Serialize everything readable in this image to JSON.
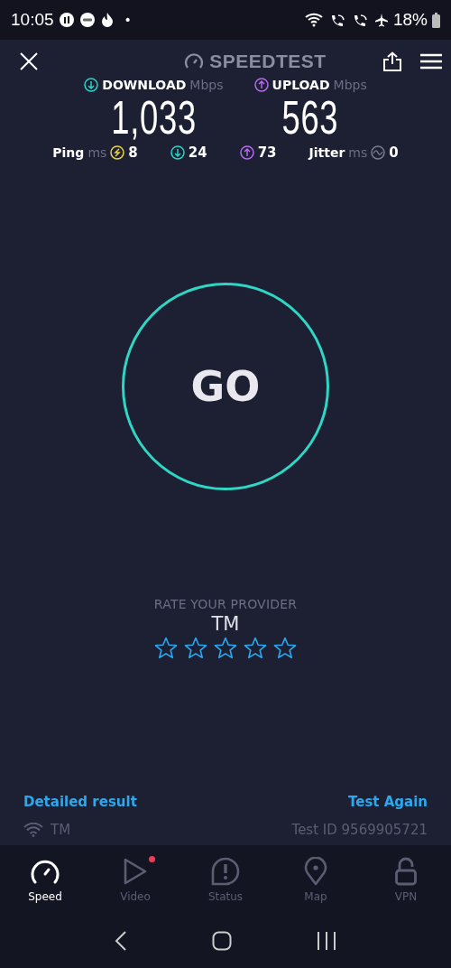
{
  "status_bar": {
    "time": "10:05",
    "dot": "•",
    "battery": "18%"
  },
  "header": {
    "title": "SPEEDTEST"
  },
  "results": [
    {
      "kind": "download",
      "label": "DOWNLOAD",
      "unit": "Mbps",
      "value": "1,033"
    },
    {
      "kind": "upload",
      "label": "UPLOAD",
      "unit": "Mbps",
      "value": "563"
    }
  ],
  "latency": [
    {
      "kind": "ping",
      "label": "Ping",
      "unit": "ms",
      "value": "8"
    },
    {
      "kind": "download",
      "value": "24"
    },
    {
      "kind": "upload",
      "value": "73"
    },
    {
      "kind": "jitter",
      "label": "Jitter",
      "unit": "ms",
      "value": "0"
    }
  ],
  "go_button": {
    "label": "GO"
  },
  "rating": {
    "title": "RATE YOUR PROVIDER",
    "provider": "TM",
    "stars": 0
  },
  "footer": {
    "detail_link": "Detailed result",
    "again_link": "Test Again",
    "network": "TM",
    "test_id": "Test ID 9569905721"
  },
  "nav": [
    {
      "kind": "speed",
      "label": "Speed",
      "selected": true,
      "alert": false
    },
    {
      "kind": "video",
      "label": "Video",
      "selected": false,
      "alert": true
    },
    {
      "kind": "status",
      "label": "Status",
      "selected": false,
      "alert": false
    },
    {
      "kind": "map",
      "label": "Map",
      "selected": false,
      "alert": false
    },
    {
      "kind": "vpn",
      "label": "VPN",
      "selected": false,
      "alert": false
    }
  ]
}
